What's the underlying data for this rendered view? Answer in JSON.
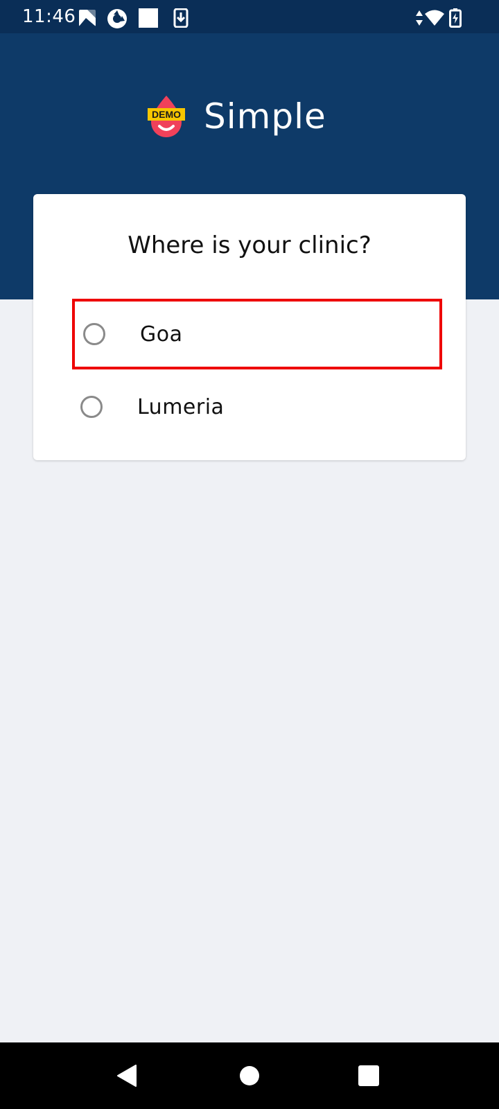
{
  "status_bar": {
    "time": "11:46",
    "icons": [
      "photo-icon",
      "camera-shutter-icon",
      "blank-square-icon",
      "download-icon",
      "data-arrows-icon",
      "wifi-icon",
      "battery-charging-icon"
    ],
    "background": "#0a2e57"
  },
  "header": {
    "logo_badge": "DEMO",
    "app_name": "Simple",
    "background": "#0e3a68"
  },
  "card": {
    "title": "Where is your clinic?",
    "options": [
      {
        "label": "Goa",
        "selected": false,
        "highlighted": true
      },
      {
        "label": "Lumeria",
        "selected": false,
        "highlighted": false
      }
    ]
  },
  "nav_bar": {
    "buttons": [
      "back-icon",
      "home-icon",
      "recents-icon"
    ]
  },
  "colors": {
    "page_background": "#eff1f5",
    "highlight_border": "#ee0000",
    "logo_drop": "#f0415a",
    "logo_badge": "#f7c600"
  }
}
